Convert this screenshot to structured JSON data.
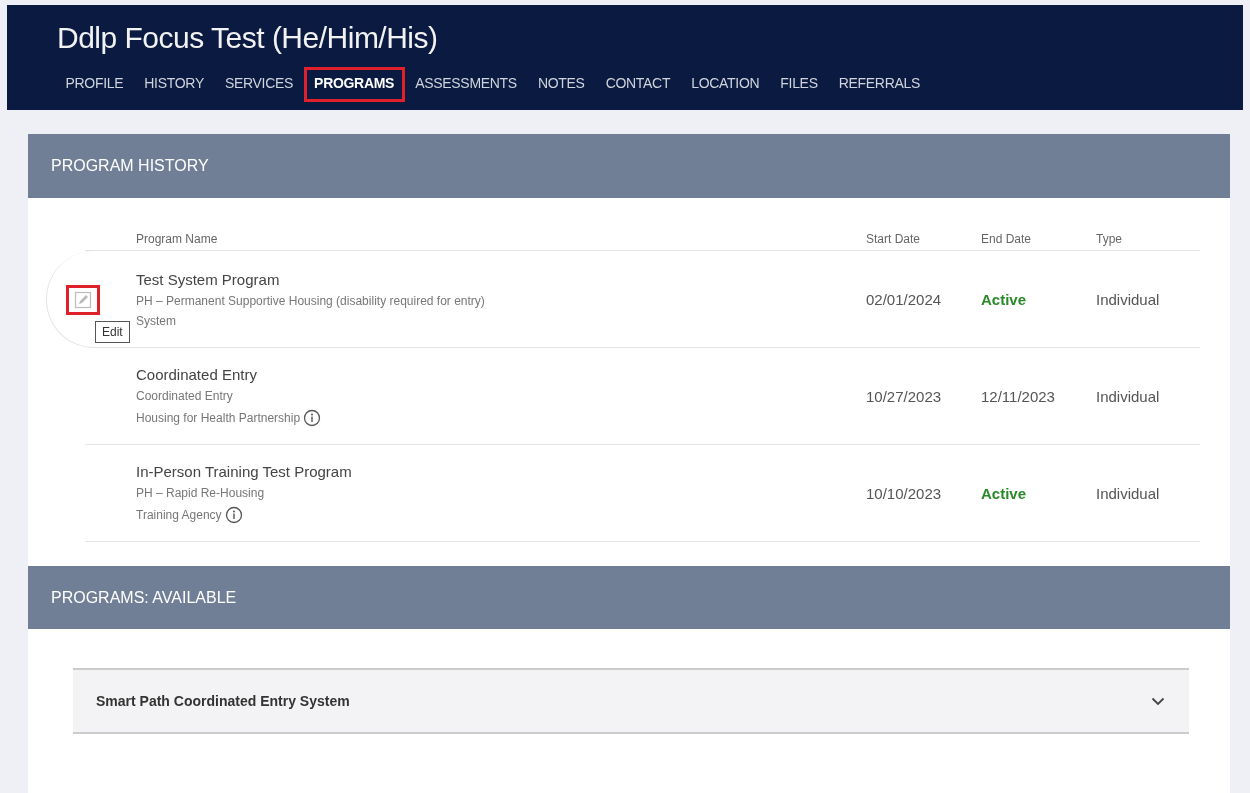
{
  "header": {
    "title": "Ddlp Focus Test (He/Him/His)",
    "tabs": [
      {
        "label": "PROFILE",
        "selected": false,
        "highlighted": false
      },
      {
        "label": "HISTORY",
        "selected": false,
        "highlighted": false
      },
      {
        "label": "SERVICES",
        "selected": false,
        "highlighted": false
      },
      {
        "label": "PROGRAMS",
        "selected": true,
        "highlighted": true
      },
      {
        "label": "ASSESSMENTS",
        "selected": false,
        "highlighted": false
      },
      {
        "label": "NOTES",
        "selected": false,
        "highlighted": false
      },
      {
        "label": "CONTACT",
        "selected": false,
        "highlighted": false
      },
      {
        "label": "LOCATION",
        "selected": false,
        "highlighted": false
      },
      {
        "label": "FILES",
        "selected": false,
        "highlighted": false
      },
      {
        "label": "REFERRALS",
        "selected": false,
        "highlighted": false
      }
    ]
  },
  "program_history": {
    "title": "PROGRAM HISTORY",
    "columns": [
      "Program Name",
      "Start Date",
      "End Date",
      "Type"
    ],
    "rows": [
      {
        "name": "Test System Program",
        "project": "PH – Permanent Supportive Housing (disability required for entry)",
        "agency": "System",
        "agency_info": false,
        "start": "02/01/2024",
        "end": "Active",
        "end_active": true,
        "type": "Individual",
        "hovered": true,
        "edit_highlighted": true,
        "tooltip": "Edit"
      },
      {
        "name": "Coordinated Entry",
        "project": "Coordinated Entry",
        "agency": "Housing for Health Partnership",
        "agency_info": true,
        "start": "10/27/2023",
        "end": "12/11/2023",
        "end_active": false,
        "type": "Individual",
        "hovered": false
      },
      {
        "name": "In-Person Training Test Program",
        "project": "PH – Rapid Re-Housing",
        "agency": "Training Agency",
        "agency_info": true,
        "start": "10/10/2023",
        "end": "Active",
        "end_active": true,
        "type": "Individual",
        "hovered": false
      }
    ]
  },
  "programs_available": {
    "title": "PROGRAMS: AVAILABLE",
    "items": [
      {
        "label": "Smart Path Coordinated Entry System",
        "expanded": false
      }
    ]
  }
}
